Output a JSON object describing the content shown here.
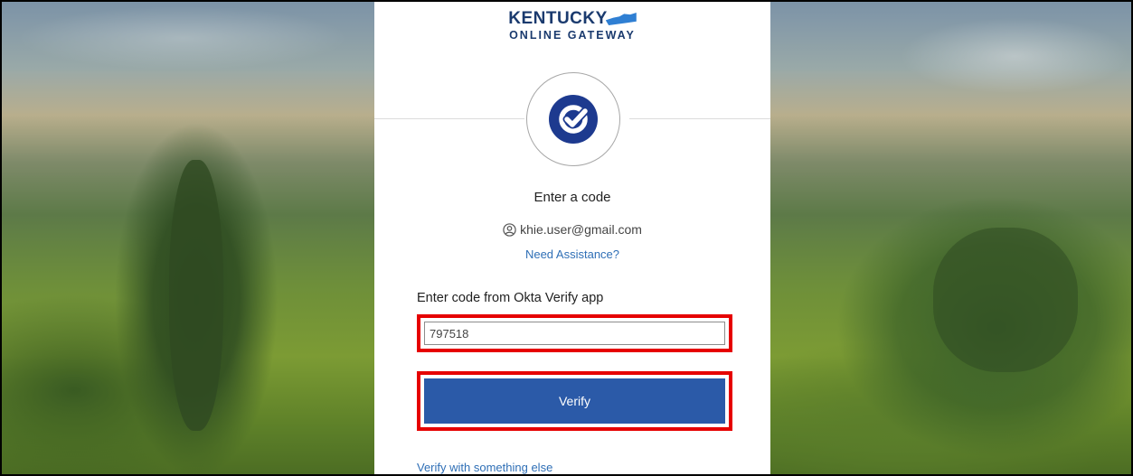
{
  "logo": {
    "line1": "KENTUCKY",
    "line2": "ONLINE GATEWAY"
  },
  "title": "Enter a code",
  "user": {
    "email": "khie.user@gmail.com",
    "icon": "user-circle-icon"
  },
  "links": {
    "assistance": "Need Assistance?",
    "verify_else": "Verify with something else"
  },
  "form": {
    "label": "Enter code from Okta Verify app",
    "code_value": "797518"
  },
  "buttons": {
    "verify": "Verify"
  },
  "colors": {
    "brand_navy": "#1a3a6e",
    "badge_blue": "#1d3a8f",
    "button_blue": "#2b5aa8",
    "link_blue": "#2f6fb6",
    "highlight_red": "#e60000"
  }
}
